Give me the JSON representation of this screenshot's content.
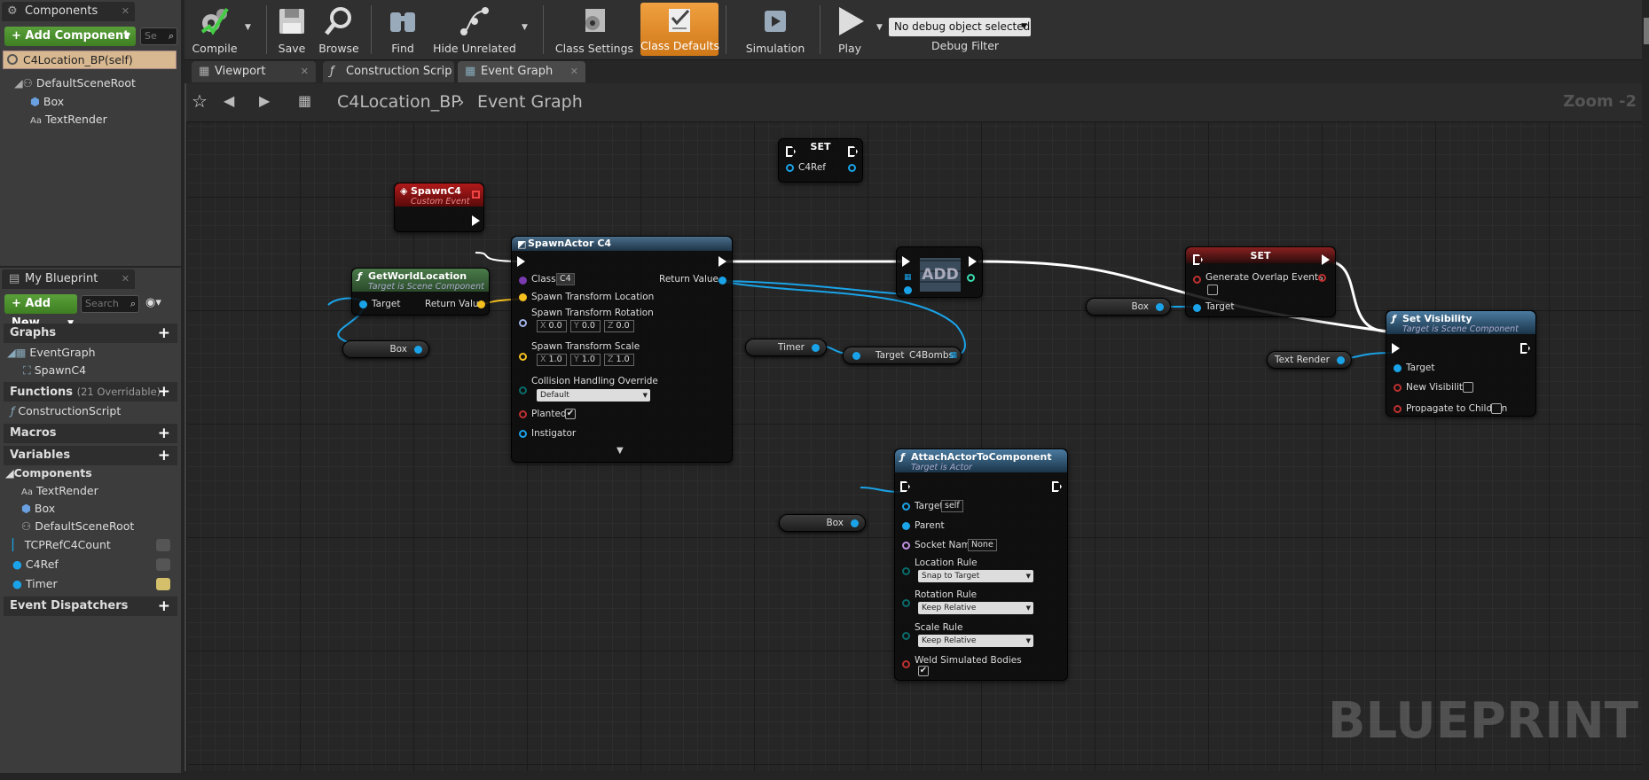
{
  "components_panel": {
    "tab_label": "Components",
    "add_component_label": "+ Add Component",
    "search_placeholder": "Se",
    "self_item": "C4Location_BP(self)",
    "tree": [
      "DefaultSceneRoot",
      "Box",
      "TextRender"
    ]
  },
  "my_blueprint": {
    "tab_label": "My Blueprint",
    "add_new_label": "+ Add New",
    "search_placeholder": "Search",
    "sections": {
      "graphs": "Graphs",
      "functions": "Functions",
      "functions_sub": "(21 Overridable)",
      "macros": "Macros",
      "variables": "Variables",
      "event_dispatchers": "Event Dispatchers"
    },
    "graph_items": [
      "EventGraph",
      "SpawnC4"
    ],
    "function_items": [
      "ConstructionScript"
    ],
    "components_header": "Components",
    "component_vars": [
      "TextRender",
      "Box",
      "DefaultSceneRoot"
    ],
    "variables": [
      "TCPRefC4Count",
      "C4Ref",
      "Timer"
    ]
  },
  "toolbar": {
    "compile": "Compile",
    "save": "Save",
    "browse": "Browse",
    "find": "Find",
    "hide_unrelated": "Hide Unrelated",
    "class_settings": "Class Settings",
    "class_defaults": "Class Defaults",
    "simulation": "Simulation",
    "play": "Play",
    "debug_select": "No debug object selected",
    "debug_filter": "Debug Filter"
  },
  "doc_tabs": [
    "Viewport",
    "Construction Scrip",
    "Event Graph"
  ],
  "breadcrumb": {
    "blueprint": "C4Location_BP",
    "graph": "Event Graph"
  },
  "zoom": "Zoom -2",
  "watermark": "BLUEPRINT",
  "nodes": {
    "set_c4ref": {
      "title": "SET",
      "pin": "C4Ref"
    },
    "spawn_event": {
      "title": "SpawnC4",
      "subtitle": "Custom Event"
    },
    "get_world_location": {
      "title": "GetWorldLocation",
      "subtitle": "Target is Scene Component",
      "target": "Target",
      "return": "Return Value"
    },
    "box_var1": "Box",
    "spawn_actor": {
      "title": "SpawnActor C4",
      "class": "Class",
      "class_val": "C4",
      "return": "Return Value",
      "loc": "Spawn Transform Location",
      "rot": "Spawn Transform Rotation",
      "rot_vals": [
        "X",
        "0.0",
        "Y",
        "0.0",
        "Z",
        "0.0"
      ],
      "scale": "Spawn Transform Scale",
      "scale_vals": [
        "X",
        "1.0",
        "Y",
        "1.0",
        "Z",
        "1.0"
      ],
      "collision": "Collision Handling Override",
      "collision_val": "Default",
      "planted": "Planted",
      "instigator": "Instigator"
    },
    "add": {
      "title": "ADD"
    },
    "timer_var": "Timer",
    "c4bombs": {
      "target": "Target",
      "name": "C4Bombs"
    },
    "set_overlap": {
      "title": "SET",
      "pin": "Generate Overlap Events",
      "target": "Target"
    },
    "box_var2": "Box",
    "set_visibility": {
      "title": "Set Visibility",
      "subtitle": "Target is Scene Component",
      "target": "Target",
      "new_vis": "New Visibility",
      "propagate": "Propagate to Children"
    },
    "text_render_var": "Text Render",
    "attach": {
      "title": "AttachActorToComponent",
      "subtitle": "Target is Actor",
      "target": "Target",
      "target_val": "self",
      "parent": "Parent",
      "socket": "Socket Name",
      "socket_val": "None",
      "loc_rule": "Location Rule",
      "loc_val": "Snap to Target",
      "rot_rule": "Rotation Rule",
      "rot_val": "Keep Relative",
      "scale_rule": "Scale Rule",
      "scale_val": "Keep Relative",
      "weld": "Weld Simulated Bodies"
    },
    "box_var3": "Box"
  },
  "colors": {
    "exec": "#ffffff",
    "object": "#1aa3e8",
    "vector": "#f4c020",
    "bool": "#c03030",
    "func_header": "#3a6a8a",
    "event_header": "#8a1a1a",
    "accent_orange": "#e8a030"
  }
}
